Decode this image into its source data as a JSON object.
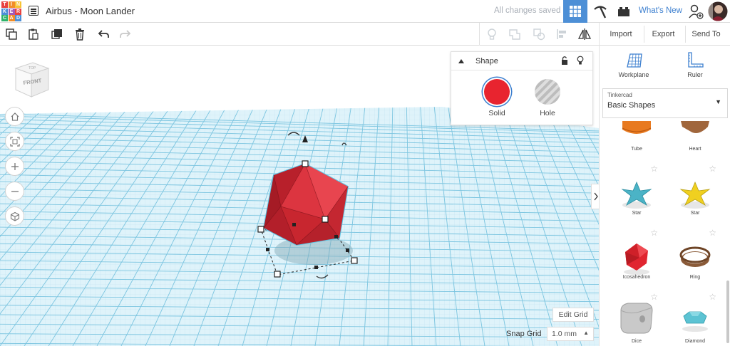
{
  "app": {
    "logo_letters": [
      "T",
      "I",
      "N",
      "K",
      "E",
      "R",
      "C",
      "A",
      "D"
    ],
    "logo_colors": [
      "#e8423f",
      "#f28d28",
      "#f7c334",
      "#4d8fd6",
      "#a55bb7",
      "#e8423f",
      "#2db36a",
      "#f28d28",
      "#4d8fd6"
    ],
    "design_title": "Airbus - Moon Lander",
    "save_status": "All changes saved",
    "whats_new": "What's New"
  },
  "toolbar": {
    "import_label": "Import",
    "export_label": "Export",
    "sendto_label": "Send To"
  },
  "viewcube": {
    "top_label": "TOP",
    "front_label": "FRONT"
  },
  "shape_panel": {
    "title": "Shape",
    "solid_label": "Solid",
    "hole_label": "Hole",
    "solid_color": "#e8242f"
  },
  "grid": {
    "edit_grid_label": "Edit Grid",
    "snap_label": "Snap Grid",
    "snap_value": "1.0 mm"
  },
  "sidebar": {
    "workplane_label": "Workplane",
    "ruler_label": "Ruler",
    "library_small": "Tinkercad",
    "library_value": "Basic Shapes",
    "shapes": [
      {
        "name": "Tube",
        "color": "#e87a20"
      },
      {
        "name": "Heart",
        "color": "#a0663c"
      },
      {
        "name": "Star",
        "color": "#4bb3c6"
      },
      {
        "name": "Star",
        "color": "#f0d020"
      },
      {
        "name": "Icosahedron",
        "color": "#e02530"
      },
      {
        "name": "Ring",
        "color": "#8a5a38"
      },
      {
        "name": "Dice",
        "color": "#c9c9c9"
      },
      {
        "name": "Diamond",
        "color": "#5cc3d3"
      }
    ]
  }
}
